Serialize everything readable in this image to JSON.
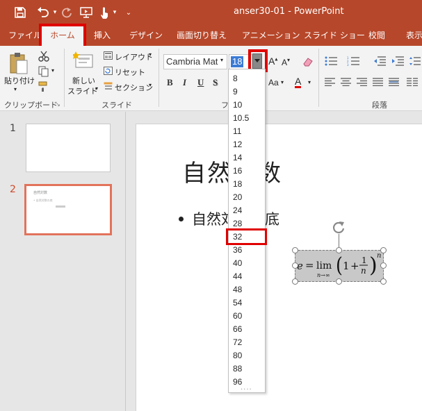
{
  "window": {
    "title": "anser30-01  -  PowerPoint"
  },
  "quick_access": {
    "icons": [
      "save-icon",
      "undo-icon",
      "redo-icon",
      "present-from-start-icon",
      "touch-mode-icon",
      "customize-qat-icon"
    ]
  },
  "ribbon_tabs": [
    {
      "label": "ファイル"
    },
    {
      "label": "ホーム"
    },
    {
      "label": "挿入"
    },
    {
      "label": "デザイン"
    },
    {
      "label": "画面切り替え"
    },
    {
      "label": "アニメーション"
    },
    {
      "label": "スライド ショー"
    },
    {
      "label": "校閲"
    },
    {
      "label": "表示"
    }
  ],
  "clipboard": {
    "paste_label": "貼り付け",
    "group_label": "クリップボード"
  },
  "slides_group": {
    "new_slide_line1": "新しい",
    "new_slide_line2": "スライド",
    "layout_label": "レイアウト",
    "reset_label": "リセット",
    "section_label": "セクション",
    "group_label": "スライド"
  },
  "font_group": {
    "font_name": "Cambria Mat",
    "font_size": "18",
    "group_label": "フ"
  },
  "paragraph_group": {
    "group_label": "段落"
  },
  "font_size_list": [
    "8",
    "9",
    "10",
    "10.5",
    "11",
    "12",
    "14",
    "16",
    "18",
    "20",
    "24",
    "28",
    "32",
    "36",
    "40",
    "44",
    "48",
    "54",
    "60",
    "66",
    "72",
    "80",
    "88",
    "96"
  ],
  "font_size_highlighted": "32",
  "slides": [
    {
      "number": "1",
      "thumb_title": "",
      "thumb_bullet": ""
    },
    {
      "number": "2",
      "thumb_title": "自然対数",
      "thumb_bullet": "• 自然対数の底"
    }
  ],
  "slide": {
    "title": "自然対数",
    "bullet": "自然対数の底"
  },
  "colors": {
    "accent": "#b7472a",
    "annotation": "#e00000",
    "selected_thumb": "#e2735b"
  }
}
